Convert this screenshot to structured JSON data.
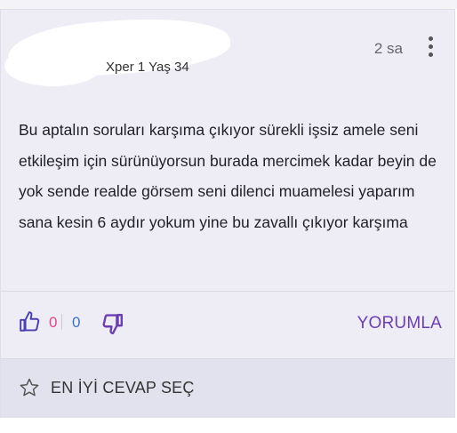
{
  "answer": {
    "user_meta": "Xper 1 Yaş 34",
    "time_ago": "2 sa",
    "more_icon": "more-vertical-icon",
    "body": "Bu aptalın soruları karşıma çıkıyor sürekli işsiz amele seni etkileşim için sürünüyorsun burada mercimek kadar beyin de yok sende realde görsem seni dilenci muamelesi yaparım sana kesin 6 aydır yokum yine bu zavallı çıkıyor karşıma"
  },
  "actions": {
    "like_icon": "thumbs-up-icon",
    "dislike_icon": "thumbs-down-icon",
    "like_count": "0",
    "dislike_count": "0",
    "reply_label": "YORUMLA"
  },
  "best_answer": {
    "icon": "star-icon",
    "label": "EN İYİ CEVAP SEÇ"
  },
  "colors": {
    "card_bg": "#eeedf6",
    "accent_purple": "#6b3fb4",
    "like_pink": "#e0478b",
    "dislike_blue": "#3b73c4"
  }
}
